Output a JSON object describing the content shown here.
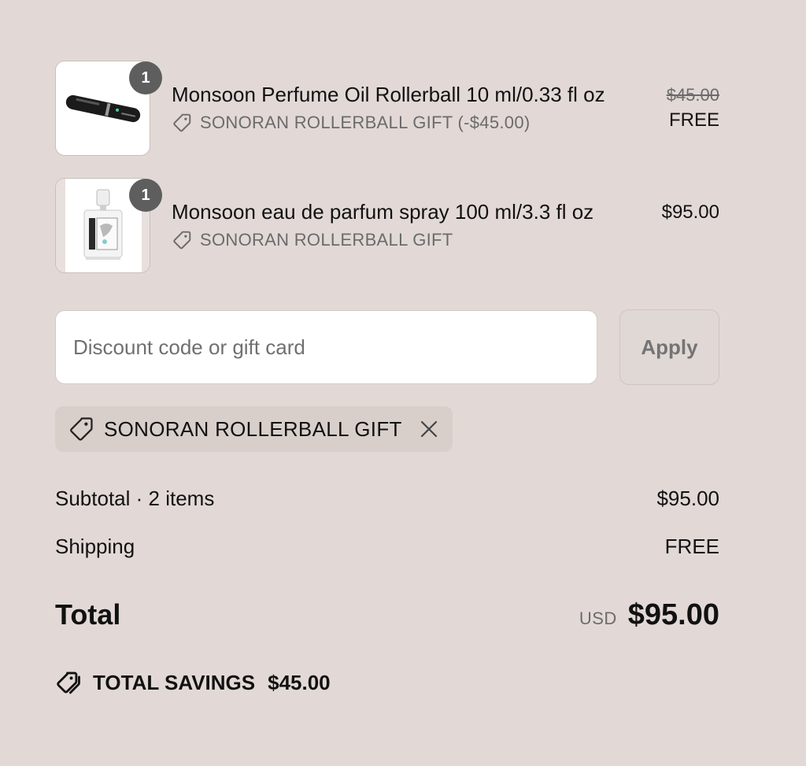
{
  "items": [
    {
      "quantity": "1",
      "title": "Monsoon Perfume Oil Rollerball 10 ml/0.33 fl oz",
      "discount_label": "SONORAN ROLLERBALL GIFT (-$45.00)",
      "original_price": "$45.00",
      "price": "FREE"
    },
    {
      "quantity": "1",
      "title": "Monsoon eau de parfum spray 100 ml/3.3 fl oz",
      "discount_label": "SONORAN ROLLERBALL GIFT",
      "price": "$95.00"
    }
  ],
  "discount": {
    "placeholder": "Discount code or gift card",
    "apply_label": "Apply",
    "applied_code": "SONORAN ROLLERBALL GIFT"
  },
  "summary": {
    "subtotal_label": "Subtotal · 2 items",
    "subtotal_value": "$95.00",
    "shipping_label": "Shipping",
    "shipping_value": "FREE",
    "total_label": "Total",
    "currency": "USD",
    "total_value": "$95.00",
    "savings_label": "TOTAL SAVINGS",
    "savings_value": "$45.00"
  },
  "colors": {
    "background": "#e2d9d6",
    "badge": "#5e5e5e",
    "muted_text": "#6b6b6b"
  }
}
